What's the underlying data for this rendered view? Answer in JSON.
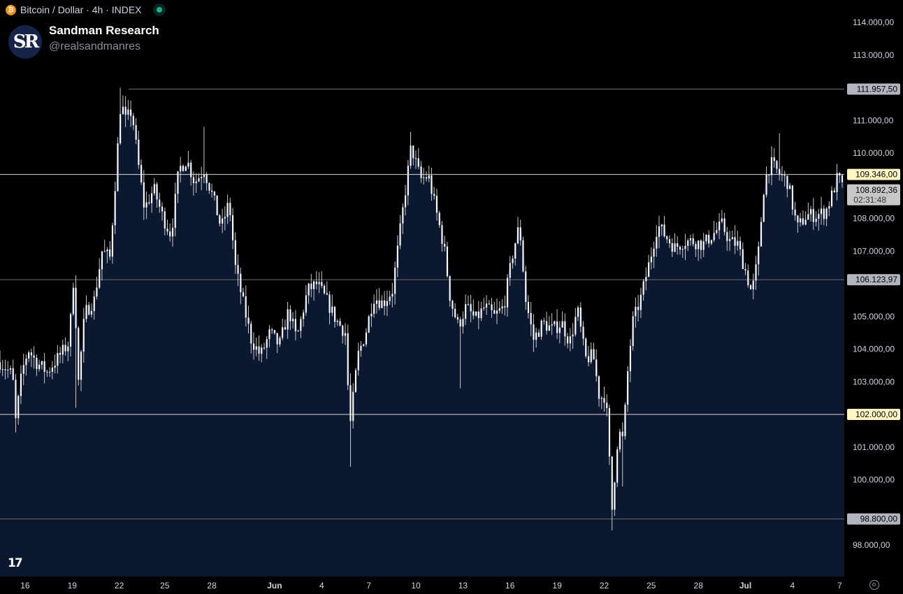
{
  "header": {
    "symbol": "Bitcoin / Dollar · 4h · INDEX",
    "btc_glyph": "₿",
    "live_icon": "live-status-dot"
  },
  "brand": {
    "logo_text": "SR",
    "name": "Sandman Research",
    "handle": "@realsandmanres"
  },
  "footer": {
    "logo_text": "17",
    "settings_icon": "gear-icon"
  },
  "colors": {
    "background": "#000000",
    "area_fill": "#0c1830",
    "candle": "#ffffff",
    "axis_text": "#d1d4dc",
    "highlight_label": "#fff6c2",
    "gray_label": "#b2b5be"
  },
  "chart_data": {
    "type": "candlestick",
    "ylim": [
      97500,
      114400
    ],
    "y_ticks": [
      {
        "value": 114000,
        "label": "114.000,00"
      },
      {
        "value": 113000,
        "label": "113.000,00"
      },
      {
        "value": 111000,
        "label": "111.000,00"
      },
      {
        "value": 110000,
        "label": "110.000,00"
      },
      {
        "value": 108000,
        "label": "108.000,00"
      },
      {
        "value": 107000,
        "label": "107.000,00"
      },
      {
        "value": 105000,
        "label": "105.000,00"
      },
      {
        "value": 104000,
        "label": "104.000,00"
      },
      {
        "value": 103000,
        "label": "103.000,00"
      },
      {
        "value": 101000,
        "label": "101.000,00"
      },
      {
        "value": 100000,
        "label": "100.000,00"
      },
      {
        "value": 98000,
        "label": "98.000,00"
      }
    ],
    "x_ticks": [
      {
        "pos": 1.6,
        "label": "16"
      },
      {
        "pos": 4.6,
        "label": "19"
      },
      {
        "pos": 7.6,
        "label": "22"
      },
      {
        "pos": 10.5,
        "label": "25"
      },
      {
        "pos": 13.5,
        "label": "28"
      },
      {
        "pos": 17.5,
        "label": "Jun"
      },
      {
        "pos": 20.5,
        "label": "4"
      },
      {
        "pos": 23.5,
        "label": "7"
      },
      {
        "pos": 26.5,
        "label": "10"
      },
      {
        "pos": 29.5,
        "label": "13"
      },
      {
        "pos": 32.5,
        "label": "16"
      },
      {
        "pos": 35.5,
        "label": "19"
      },
      {
        "pos": 38.5,
        "label": "22"
      },
      {
        "pos": 41.5,
        "label": "25"
      },
      {
        "pos": 44.5,
        "label": "28"
      },
      {
        "pos": 47.5,
        "label": "Jul"
      },
      {
        "pos": 50.5,
        "label": "4"
      },
      {
        "pos": 53.5,
        "label": "7"
      }
    ],
    "x_range_days": [
      0,
      54
    ],
    "price_lines": [
      {
        "value": 111957.5,
        "label": "111.957,50",
        "style": "gray",
        "line": "gray",
        "start_day": 8.2
      },
      {
        "value": 109346.0,
        "label": "109.346,00",
        "style": "highlight",
        "line": "light",
        "start_day": 0
      },
      {
        "value": 106123.97,
        "label": "106.123,97",
        "style": "gray",
        "line": "gray",
        "start_day": 0
      },
      {
        "value": 102000.0,
        "label": "102.000,00",
        "style": "highlight",
        "line": "light",
        "start_day": 0
      },
      {
        "value": 98800.0,
        "label": "98.800,00",
        "style": "gray",
        "line": "gray",
        "start_day": 0
      }
    ],
    "last_price": {
      "value": 108892.36,
      "label": "108.892,36",
      "countdown": "02:31:48"
    },
    "path": [
      [
        0,
        103600
      ],
      [
        0.8,
        103200
      ],
      [
        1.0,
        101800
      ],
      [
        1.4,
        103300
      ],
      [
        1.8,
        104000
      ],
      [
        2.3,
        103600
      ],
      [
        3.0,
        103300
      ],
      [
        3.8,
        103800
      ],
      [
        4.4,
        104200
      ],
      [
        4.7,
        106300
      ],
      [
        5.0,
        103000
      ],
      [
        5.4,
        105100
      ],
      [
        6.0,
        105500
      ],
      [
        6.5,
        107000
      ],
      [
        7.0,
        106800
      ],
      [
        7.3,
        108800
      ],
      [
        7.7,
        111600
      ],
      [
        8.0,
        111000
      ],
      [
        8.4,
        111300
      ],
      [
        8.8,
        109700
      ],
      [
        9.2,
        108300
      ],
      [
        9.8,
        108900
      ],
      [
        10.4,
        108000
      ],
      [
        10.9,
        107500
      ],
      [
        11.4,
        109500
      ],
      [
        11.9,
        109800
      ],
      [
        12.4,
        109100
      ],
      [
        13.0,
        109500
      ],
      [
        13.6,
        108600
      ],
      [
        14.1,
        107700
      ],
      [
        14.6,
        108500
      ],
      [
        15.0,
        106500
      ],
      [
        15.5,
        105400
      ],
      [
        16.0,
        104300
      ],
      [
        16.6,
        103800
      ],
      [
        17.2,
        104500
      ],
      [
        17.8,
        104100
      ],
      [
        18.4,
        105200
      ],
      [
        18.9,
        104300
      ],
      [
        19.6,
        105800
      ],
      [
        20.2,
        106000
      ],
      [
        20.8,
        105500
      ],
      [
        21.4,
        104900
      ],
      [
        22.0,
        104500
      ],
      [
        22.3,
        101600
      ],
      [
        22.8,
        103800
      ],
      [
        23.3,
        104500
      ],
      [
        23.8,
        105600
      ],
      [
        24.4,
        105400
      ],
      [
        25.0,
        105800
      ],
      [
        25.6,
        108000
      ],
      [
        26.2,
        110200
      ],
      [
        26.8,
        109200
      ],
      [
        27.3,
        109300
      ],
      [
        27.8,
        108200
      ],
      [
        28.3,
        107100
      ],
      [
        28.7,
        105500
      ],
      [
        29.2,
        104700
      ],
      [
        29.7,
        105300
      ],
      [
        30.3,
        104900
      ],
      [
        30.9,
        105300
      ],
      [
        31.5,
        105000
      ],
      [
        32.1,
        105300
      ],
      [
        32.7,
        107000
      ],
      [
        33.1,
        107800
      ],
      [
        33.5,
        105500
      ],
      [
        34.0,
        104300
      ],
      [
        34.6,
        104800
      ],
      [
        35.2,
        104600
      ],
      [
        35.8,
        104800
      ],
      [
        36.3,
        104200
      ],
      [
        36.8,
        105200
      ],
      [
        37.3,
        103700
      ],
      [
        37.8,
        103800
      ],
      [
        38.2,
        102500
      ],
      [
        38.6,
        102600
      ],
      [
        39.0,
        99100
      ],
      [
        39.4,
        101500
      ],
      [
        39.7,
        101200
      ],
      [
        40.0,
        103300
      ],
      [
        40.3,
        104800
      ],
      [
        40.8,
        105500
      ],
      [
        41.4,
        106700
      ],
      [
        41.9,
        107800
      ],
      [
        42.5,
        107400
      ],
      [
        43.0,
        107100
      ],
      [
        43.6,
        107300
      ],
      [
        44.2,
        107300
      ],
      [
        44.8,
        107200
      ],
      [
        45.4,
        107500
      ],
      [
        46.0,
        107800
      ],
      [
        46.5,
        107300
      ],
      [
        47.0,
        107200
      ],
      [
        47.5,
        106400
      ],
      [
        47.9,
        105700
      ],
      [
        48.3,
        106800
      ],
      [
        48.7,
        109100
      ],
      [
        49.1,
        109700
      ],
      [
        49.6,
        109400
      ],
      [
        50.2,
        109100
      ],
      [
        50.8,
        107700
      ],
      [
        51.4,
        108100
      ],
      [
        52.0,
        108100
      ],
      [
        52.6,
        108200
      ],
      [
        53.0,
        108700
      ],
      [
        53.4,
        109300
      ],
      [
        53.7,
        108892
      ]
    ]
  }
}
